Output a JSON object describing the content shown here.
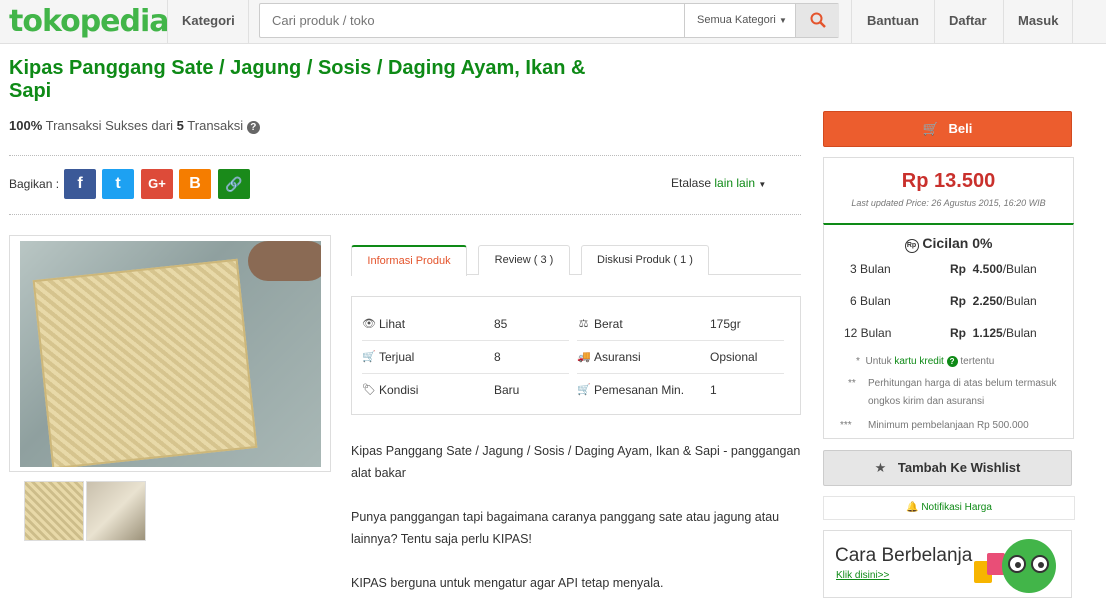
{
  "header": {
    "logo": "tokopedia",
    "kategori": "Kategori",
    "search_placeholder": "Cari produk / toko",
    "search_category": "Semua Kategori",
    "bantuan": "Bantuan",
    "daftar": "Daftar",
    "masuk": "Masuk"
  },
  "product": {
    "title": "Kipas Panggang Sate / Jagung / Sosis / Daging Ayam, Ikan & Sapi",
    "tx_percent": "100%",
    "tx_mid": "Transaksi Sukses dari",
    "tx_count": "5",
    "tx_end": "Transaksi"
  },
  "share": {
    "label": "Bagikan :",
    "facebook": "f",
    "twitter": "t",
    "gplus": "G+",
    "blogger": "B",
    "link": "🔗",
    "etalase_label": "Etalase",
    "etalase_value": "lain lain"
  },
  "tabs": [
    {
      "label": "Informasi Produk"
    },
    {
      "label": "Review ( 3 )"
    },
    {
      "label": "Diskusi Produk ( 1 )"
    }
  ],
  "info": {
    "lihat_label": "Lihat",
    "lihat_value": "85",
    "terjual_label": "Terjual",
    "terjual_value": "8",
    "kondisi_label": "Kondisi",
    "kondisi_value": "Baru",
    "berat_label": "Berat",
    "berat_value": "175gr",
    "asuransi_label": "Asuransi",
    "asuransi_value": "Opsional",
    "pemesanan_label": "Pemesanan Min.",
    "pemesanan_value": "1"
  },
  "description": {
    "p1": "Kipas Panggang Sate / Jagung / Sosis / Daging Ayam, Ikan & Sapi - panggangan alat bakar",
    "p2": "Punya panggangan tapi bagaimana caranya panggang sate atau jagung atau lainnya? Tentu saja perlu KIPAS!",
    "p3": "KIPAS berguna untuk mengatur agar API tetap menyala."
  },
  "buy": {
    "beli": "Beli",
    "price": "Rp 13.500",
    "last_updated": "Last updated Price: 26 Agustus 2015, 16:20 WIB"
  },
  "cicilan": {
    "title": "Cicilan 0%",
    "rows": [
      {
        "term": "3 Bulan",
        "amount": "4.500",
        "unit": "/Bulan"
      },
      {
        "term": "6 Bulan",
        "amount": "2.250",
        "unit": "/Bulan"
      },
      {
        "term": "12 Bulan",
        "amount": "1.125",
        "unit": "/Bulan"
      }
    ],
    "currency": "Rp",
    "note1_pre": "Untuk",
    "note1_link": "kartu kredit",
    "note1_post": "tertentu",
    "note2": "Perhitungan harga di atas belum termasuk ongkos kirim dan asuransi",
    "note3": "Minimum pembelanjaan Rp 500.000"
  },
  "wishlist": "Tambah Ke Wishlist",
  "notifikasi": "Notifikasi Harga",
  "banner": {
    "title": "Cara Berbelanja",
    "link": "Klik disini>>"
  }
}
